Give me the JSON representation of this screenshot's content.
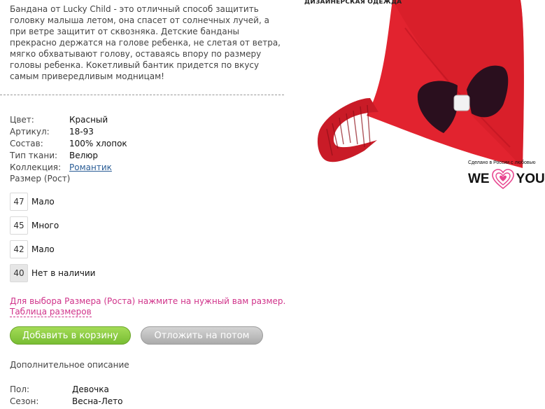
{
  "description": "Бандана от Lucky Child - это отличный способ защитить головку малыша летом, она спасет от солнечных лучей, а при ветре защитит от сквозняка. Детские банданы прекрасно держатся на голове ребенка, не слетая от ветра, мягко обхватывают голову, оставаясь впору по размеру головы ребенка. Кокетливый бантик придется по вкусу самым привередливым модницам!",
  "properties": [
    {
      "label": "Цвет:",
      "value": "Красный"
    },
    {
      "label": "Артикул:",
      "value": "18-93"
    },
    {
      "label": "Состав:",
      "value": "100% хлопок"
    },
    {
      "label": "Тип ткани:",
      "value": "Велюр"
    },
    {
      "label": "Коллекция:",
      "value": "Романтик"
    }
  ],
  "size_title": "Размер (Рост)",
  "sizes": [
    {
      "size": "47",
      "status": "Мало"
    },
    {
      "size": "45",
      "status": "Много"
    },
    {
      "size": "42",
      "status": "Мало"
    },
    {
      "size": "40",
      "status": "Нет в наличии"
    }
  ],
  "hint_text": "Для выбора Размера (Роста) нажмите на нужный вам размер.",
  "size_table_link": "Таблица размеров",
  "buttons": {
    "add_to_cart": "Добавить в корзину",
    "save_for_later": "Отложить на потом"
  },
  "additional_title": "Дополнительное описание",
  "extra": [
    {
      "label": "Пол:",
      "value": "Девочка"
    },
    {
      "label": "Сезон:",
      "value": "Весна-Лето"
    }
  ],
  "image": {
    "caption_top": "ДИЗАЙНЕРСКАЯ  ОДЕЖДА",
    "made_in": "Сделано в России с любовью",
    "logo_left": "WE",
    "logo_right": "YOU"
  },
  "colors": {
    "accent_pink": "#d0338a",
    "bandana_red": "#e2232f",
    "bow_dark": "#2a0f1e",
    "cart_green": "#8ccb44",
    "link_blue": "#2a5d96"
  }
}
